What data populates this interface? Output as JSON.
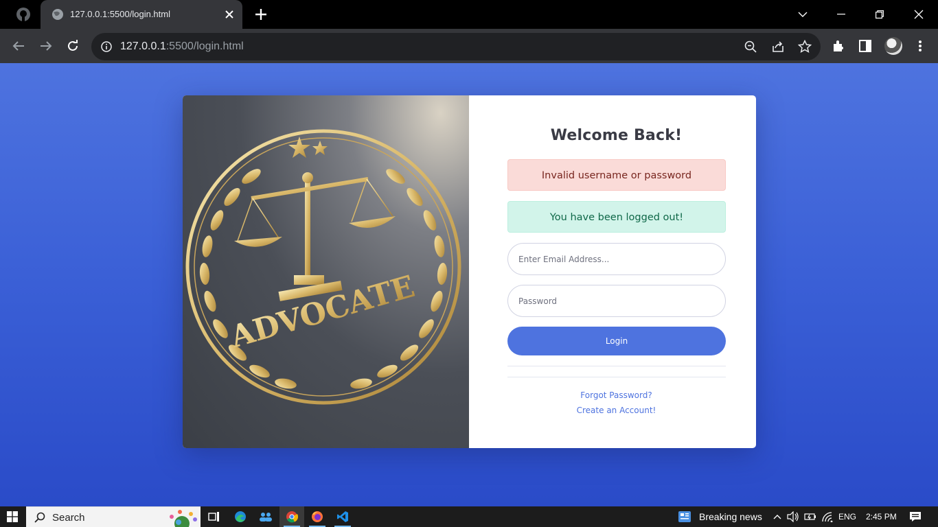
{
  "browser": {
    "tab_title": "127.0.0.1:5500/login.html",
    "url_host": "127.0.0.1",
    "url_rest": ":5500/login.html"
  },
  "page": {
    "image_text": "ADVOCATE",
    "heading": "Welcome Back!",
    "alert_error": "Invalid username or password",
    "alert_success": "You have been logged out!",
    "email_placeholder": "Enter Email Address...",
    "password_placeholder": "Password",
    "login_label": "Login",
    "forgot_link": "Forgot Password?",
    "create_link": "Create an Account!",
    "colors": {
      "primary": "#4e73df",
      "danger_bg": "#fadbd8",
      "success_bg": "#d2f4ea"
    }
  },
  "taskbar": {
    "search_label": "Search",
    "news_label": "Breaking news",
    "language": "ENG",
    "time": "2:45 PM"
  }
}
